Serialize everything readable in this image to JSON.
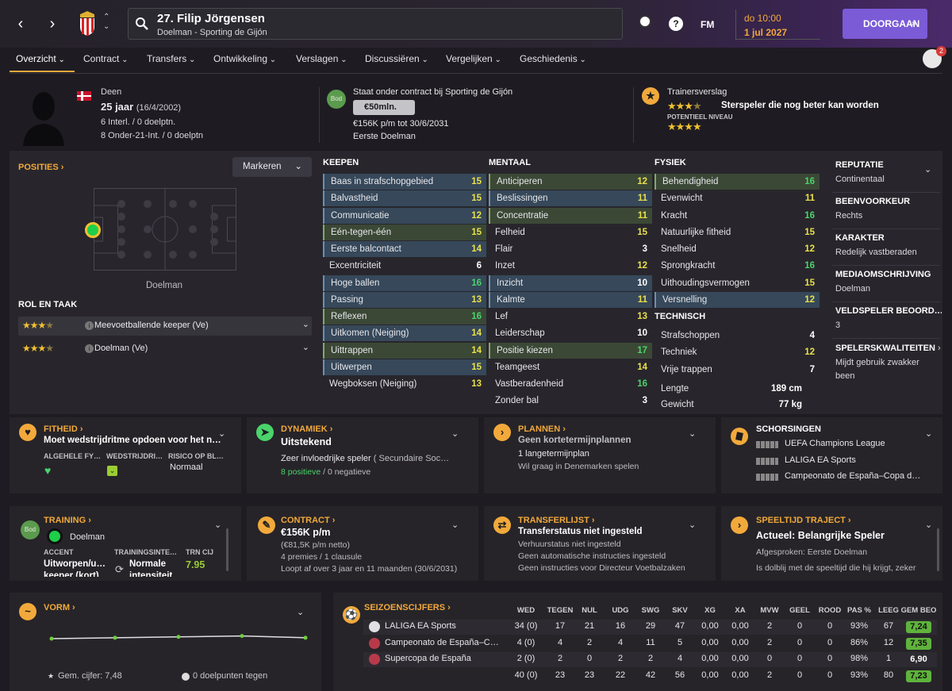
{
  "topbar": {
    "player_name": "27. Filip Jörgensen",
    "player_sub": "Doelman - Sporting de Gijón",
    "time": "do 10:00",
    "date": "1 jul 2027",
    "continue_label": "DOORGAAN",
    "fm_label": "FM",
    "help_label": "?"
  },
  "tabs": [
    "Overzicht",
    "Contract",
    "Transfers",
    "Ontwikkeling",
    "Verslagen",
    "Discussiëren",
    "Vergelijken",
    "Geschiedenis"
  ],
  "notifications": "2",
  "profile": {
    "nationality": "Deen",
    "age": "25 jaar",
    "dob": "(16/4/2002)",
    "caps": "6 Interl. / 0 doelptn.",
    "u21": "8 Onder-21-Int. / 0 doelptn"
  },
  "contract_head": {
    "status": "Staat onder contract bij Sporting de Gijón",
    "badge": "Bod",
    "value": "€50mln.",
    "wage": "€156K p/m tot 30/6/2031",
    "role": "Eerste Doelman"
  },
  "coach_report": {
    "title": "Trainersverslag",
    "summary": "Sterspeler die nog beter kan worden",
    "potential_label": "POTENTIEEL NIVEAU",
    "current_stars": 3.5,
    "potential_stars": 4
  },
  "positions": {
    "title": "POSITIES",
    "mark_label": "Markeren",
    "position_name": "Doelman"
  },
  "roles": {
    "title": "ROL EN TAAK",
    "items": [
      {
        "label": "Meevoetballende keeper (Ve)",
        "stars": 3.5
      },
      {
        "label": "Doelman (Ve)",
        "stars": 3.5
      }
    ]
  },
  "keeping": {
    "title": "KEEPEN",
    "items": [
      {
        "name": "Baas in strafschopgebied",
        "value": "15"
      },
      {
        "name": "Balvastheid",
        "value": "15"
      },
      {
        "name": "Communicatie",
        "value": "12"
      },
      {
        "name": "Eén-tegen-één",
        "value": "15"
      },
      {
        "name": "Eerste balcontact",
        "value": "14"
      },
      {
        "name": "Excentriciteit",
        "value": "6"
      },
      {
        "name": "Hoge ballen",
        "value": "16"
      },
      {
        "name": "Passing",
        "value": "13"
      },
      {
        "name": "Reflexen",
        "value": "16"
      },
      {
        "name": "Uitkomen (Neiging)",
        "value": "14"
      },
      {
        "name": "Uittrappen",
        "value": "14"
      },
      {
        "name": "Uitwerpen",
        "value": "15"
      },
      {
        "name": "Wegboksen (Neiging)",
        "value": "13"
      }
    ]
  },
  "mental": {
    "title": "MENTAAL",
    "items": [
      {
        "name": "Anticiperen",
        "value": "12"
      },
      {
        "name": "Beslissingen",
        "value": "11"
      },
      {
        "name": "Concentratie",
        "value": "11"
      },
      {
        "name": "Felheid",
        "value": "15"
      },
      {
        "name": "Flair",
        "value": "3"
      },
      {
        "name": "Inzet",
        "value": "12"
      },
      {
        "name": "Inzicht",
        "value": "10"
      },
      {
        "name": "Kalmte",
        "value": "11"
      },
      {
        "name": "Lef",
        "value": "13"
      },
      {
        "name": "Leiderschap",
        "value": "10"
      },
      {
        "name": "Positie kiezen",
        "value": "17"
      },
      {
        "name": "Teamgeest",
        "value": "14"
      },
      {
        "name": "Vastberadenheid",
        "value": "16"
      },
      {
        "name": "Zonder bal",
        "value": "3"
      }
    ]
  },
  "physical": {
    "title": "FYSIEK",
    "items": [
      {
        "name": "Behendigheid",
        "value": "16"
      },
      {
        "name": "Evenwicht",
        "value": "11"
      },
      {
        "name": "Kracht",
        "value": "16"
      },
      {
        "name": "Natuurlijke fitheid",
        "value": "15"
      },
      {
        "name": "Snelheid",
        "value": "12"
      },
      {
        "name": "Sprongkracht",
        "value": "16"
      },
      {
        "name": "Uithoudingsvermogen",
        "value": "15"
      },
      {
        "name": "Versnelling",
        "value": "12"
      }
    ]
  },
  "technical": {
    "title": "TECHNISCH",
    "items": [
      {
        "name": "Strafschoppen",
        "value": "4"
      },
      {
        "name": "Techniek",
        "value": "12"
      },
      {
        "name": "Vrije trappen",
        "value": "7"
      }
    ]
  },
  "body": {
    "height_label": "Lengte",
    "height": "189 cm",
    "weight_label": "Gewicht",
    "weight": "77 kg"
  },
  "info": [
    {
      "key": "REPUTATIE",
      "value": "Continentaal"
    },
    {
      "key": "BEENVOORKEUR",
      "value": "Rechts"
    },
    {
      "key": "KARAKTER",
      "value": "Redelijk vastberaden"
    },
    {
      "key": "MEDIAOMSCHRIJVING",
      "value": "Doelman"
    },
    {
      "key": "VELDSPELER BEOORD…",
      "value": "3"
    },
    {
      "key": "SPELERSKWALITEITEN",
      "value": "Mijdt gebruik zwakker",
      "value2": "been"
    }
  ],
  "fitness": {
    "title": "FITHEID",
    "main": "Moet wedstrijdritme opdoen voor het n…",
    "col1": "ALGEHELE FY…",
    "col2": "WEDSTRIJDRI…",
    "col3": "RISICO OP BL…",
    "risk": "Normaal"
  },
  "dynamics": {
    "title": "DYNAMIEK",
    "main": "Uitstekend",
    "text": "Zeer invloedrijke speler",
    "text2": "( Secundaire Soc…",
    "positive": "8 positieve",
    "negative": "/ 0 negatieve"
  },
  "plans": {
    "title": "PLANNEN",
    "main": "Geen kortetermijnplannen",
    "text": "1 langetermijnplan",
    "sub": "Wil graag in Denemarken spelen"
  },
  "suspensions": {
    "title": "SCHORSINGEN",
    "items": [
      "UEFA Champions League",
      "LALIGA EA Sports",
      "Campeonato de España–Copa d…"
    ]
  },
  "training": {
    "title": "TRAINING",
    "role": "Doelman",
    "badge": "Bod",
    "col1": "ACCENT",
    "col2": "TRAININGSINTE…",
    "col3": "TRN CIJ",
    "accent": "Uitworpen/u…",
    "accent2": "keeper (kort)",
    "intensity": "Normale",
    "intensity2": "intensiteit",
    "rating": "7.95"
  },
  "contract": {
    "title": "CONTRACT",
    "main": "€156K p/m",
    "net": "(€81,5K p/m netto)",
    "bonus": "4 premies / 1 clausule",
    "term": "Loopt af over 3 jaar en 11 maanden (30/6/2031)"
  },
  "transfer": {
    "title": "TRANSFERLIJST",
    "main": "Transferstatus niet ingesteld",
    "l1": "Verhuurstatus niet ingesteld",
    "l2": "Geen automatische instructies ingesteld",
    "l3": "Geen instructies voor Directeur Voetbalzaken"
  },
  "playtime": {
    "title": "SPEELTIJD TRAJECT",
    "main": "Actueel: Belangrijke Speler",
    "agreed": "Afgesproken: Eerste Doelman",
    "sub": "Is dolblij met de speeltijd die hij krijgt, zeker"
  },
  "form": {
    "title": "VORM",
    "avg": "Gem. cijfer: 7,48",
    "goals": "0 doelpunten tegen",
    "points": [
      7.3,
      7.35,
      7.4,
      7.45,
      7.35
    ]
  },
  "season": {
    "title": "SEIZOENSCIJFERS",
    "headers": [
      "WED",
      "TEGEN",
      "NUL",
      "UDG",
      "SWG",
      "SKV",
      "XG",
      "XA",
      "MVW",
      "GEEL",
      "ROOD",
      "PAS %",
      "LEEG",
      "GEM BEO"
    ],
    "rows": [
      {
        "comp": "LALIGA EA Sports",
        "cells": [
          "34 (0)",
          "17",
          "21",
          "16",
          "29",
          "47",
          "0,00",
          "0,00",
          "2",
          "0",
          "0",
          "93%",
          "67"
        ],
        "rating": "7,24",
        "hl": true
      },
      {
        "comp": "Campeonato de España–C…",
        "cells": [
          "4 (0)",
          "4",
          "2",
          "4",
          "11",
          "5",
          "0,00",
          "0,00",
          "2",
          "0",
          "0",
          "86%",
          "12"
        ],
        "rating": "7,35",
        "hl": true
      },
      {
        "comp": "Supercopa de España",
        "cells": [
          "2 (0)",
          "2",
          "0",
          "2",
          "2",
          "4",
          "0,00",
          "0,00",
          "0",
          "0",
          "0",
          "98%",
          "1"
        ],
        "rating": "6,90",
        "hl": false
      },
      {
        "comp": "",
        "cells": [
          "40 (0)",
          "23",
          "23",
          "22",
          "42",
          "56",
          "0,00",
          "0,00",
          "2",
          "0",
          "0",
          "93%",
          "80"
        ],
        "rating": "7,23",
        "hl": true
      }
    ]
  }
}
